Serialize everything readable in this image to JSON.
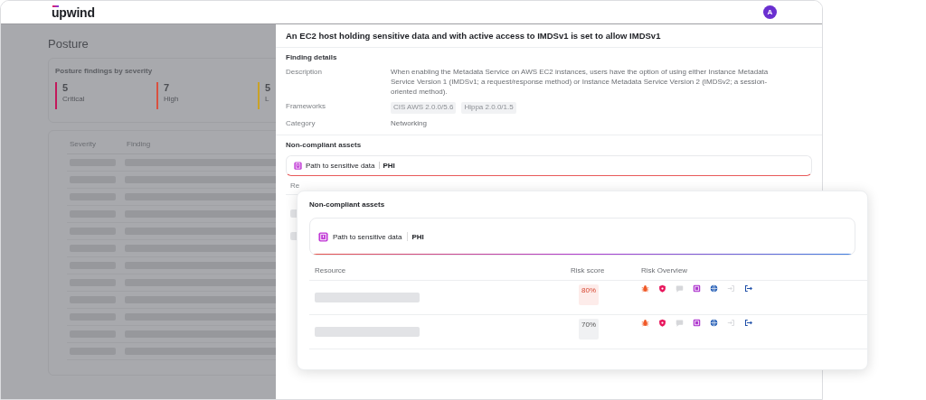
{
  "header": {
    "logo": "upwind",
    "avatar": "A"
  },
  "page": {
    "title": "Posture",
    "severity_card": {
      "title": "Posture findings by severity",
      "items": [
        {
          "count": "5",
          "label": "Critical",
          "color": "#c2185b"
        },
        {
          "count": "7",
          "label": "High",
          "color": "#d9503f"
        },
        {
          "count": "5",
          "label": "L",
          "color": "#c9a227"
        }
      ]
    },
    "findings_table": {
      "columns": [
        "Severity",
        "Finding"
      ]
    }
  },
  "drawer": {
    "title": "An EC2 host holding sensitive data and with active access to IMDSv1 is set to allow IMDSv1",
    "details_heading": "Finding details",
    "description_label": "Description",
    "description": "When enabling the Metadata Service on AWS EC2 instances, users have the option of using either Instance Metadata Service Version 1 (IMDSv1; a request/response method) or Instance Metadata Service Version 2 (IMDSv2; a session-oriented method).",
    "frameworks_label": "Frameworks",
    "frameworks": [
      "CIS AWS 2.0.0/5.6",
      "Hippa 2.0.0/1.5"
    ],
    "category_label": "Category",
    "category": "Networking",
    "assets_heading": "Non-compliant assets",
    "path_label": "Path to sensitive data",
    "path_value": "PHI",
    "column_1": "Re"
  },
  "popup": {
    "heading": "Non-compliant assets",
    "path_label": "Path to sensitive data",
    "path_value": "PHI",
    "columns": [
      "Resource",
      "Risk score",
      "Risk Overview"
    ],
    "rows": [
      {
        "score": "80%",
        "highlighted": true,
        "risks": [
          {
            "kind": "bug",
            "active": true
          },
          {
            "kind": "shield",
            "active": true
          },
          {
            "kind": "chat",
            "active": false
          },
          {
            "kind": "data",
            "active": true
          },
          {
            "kind": "globe",
            "active": true
          },
          {
            "kind": "login",
            "active": false
          },
          {
            "kind": "logout",
            "active": true
          }
        ]
      },
      {
        "score": "70%",
        "highlighted": false,
        "risks": [
          {
            "kind": "bug",
            "active": true
          },
          {
            "kind": "shield",
            "active": true
          },
          {
            "kind": "chat",
            "active": false
          },
          {
            "kind": "data",
            "active": true
          },
          {
            "kind": "globe",
            "active": true
          },
          {
            "kind": "login",
            "active": false
          },
          {
            "kind": "logout",
            "active": true
          }
        ]
      }
    ]
  }
}
